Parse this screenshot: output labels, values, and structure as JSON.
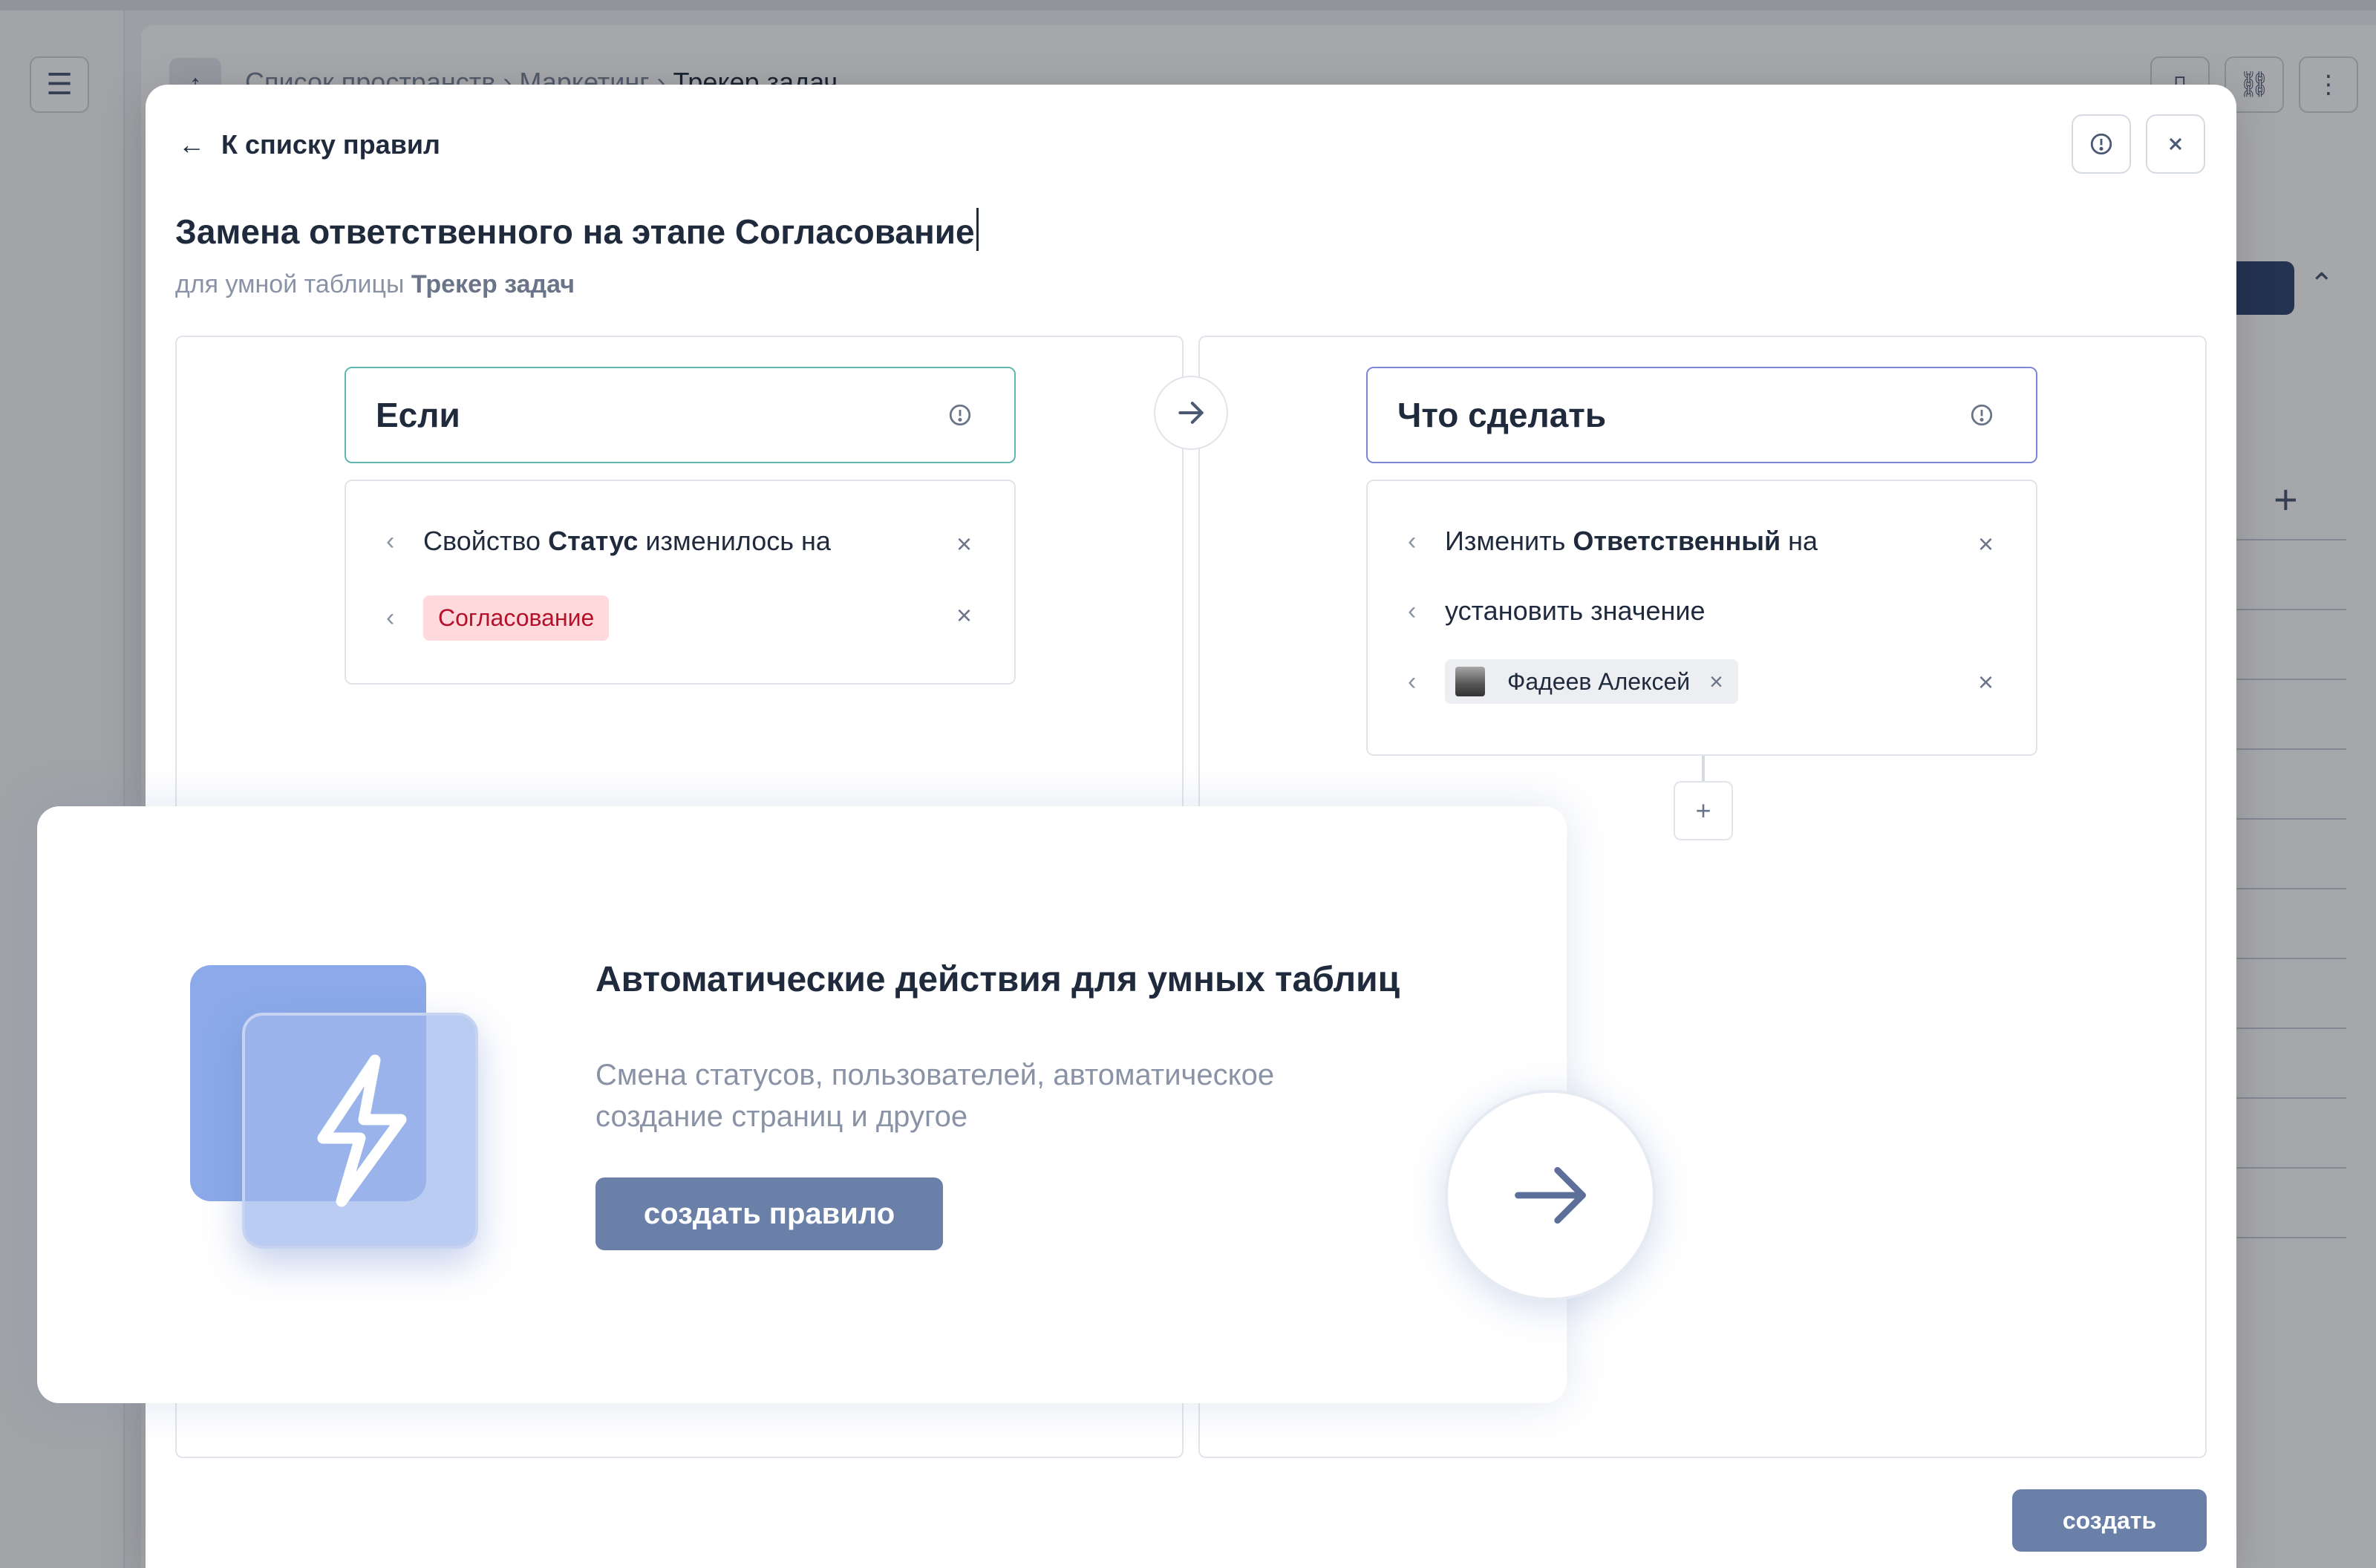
{
  "background": {
    "breadcrumb": {
      "part1": "Список пространств",
      "sep": "›",
      "part2": "Маркетинг",
      "current": "Трекер задач"
    }
  },
  "modal": {
    "back_label": "К списку правил",
    "rule_title": "Замена ответственного на этапе Согласование",
    "subtitle_prefix": "для умной таблицы",
    "subtitle_table": "Трекер задач",
    "if_section": {
      "title": "Если",
      "condition_prefix": "Свойство",
      "condition_property": "Статус",
      "condition_suffix": "изменилось на",
      "value_tag": "Согласование"
    },
    "then_section": {
      "title": "Что сделать",
      "action_prefix": "Изменить",
      "action_property": "Ответственный",
      "action_suffix": "на",
      "mode": "установить значение",
      "user": "Фадеев Алексей"
    },
    "add_symbol": "+",
    "create_label": "создать"
  },
  "promo": {
    "title": "Автоматические действия для умных таблиц",
    "description_line1": "Смена статусов, пользователей, автоматическое",
    "description_line2": "создание страниц и другое",
    "button_label": "создать правило"
  },
  "colors": {
    "accent": "#6b80a8",
    "if_border": "#5fb8ae",
    "then_border": "#7b86d6",
    "tag_bg": "#ffd9dc",
    "tag_text": "#b3122a",
    "promo_icon": "#8caae9"
  }
}
